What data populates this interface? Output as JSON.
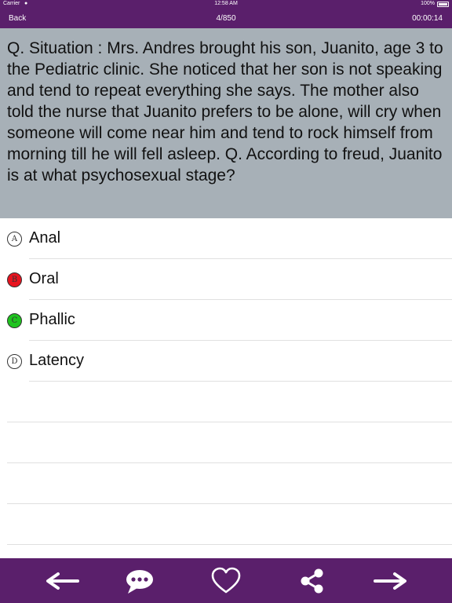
{
  "status_bar": {
    "carrier": "Carrier",
    "time": "12:58 AM",
    "battery": "100%"
  },
  "nav": {
    "back_label": "Back",
    "progress": "4/850",
    "timer": "00:00:14"
  },
  "question": {
    "text": "Q. Situation : Mrs. Andres brought his son, Juanito, age 3 to the Pediatric clinic. She noticed that her son is not speaking and tend to repeat everything she says. The mother also told the nurse that Juanito prefers to be alone, will cry when someone will come near him and tend to rock himself from morning till he will fell asleep. Q. According to freud, Juanito is at what psychosexual stage?"
  },
  "options": [
    {
      "letter": "A",
      "text": "Anal",
      "state": "neutral",
      "color": "#ffffff"
    },
    {
      "letter": "B",
      "text": "Oral",
      "state": "wrong",
      "color": "#e8131f"
    },
    {
      "letter": "C",
      "text": "Phallic",
      "state": "correct",
      "color": "#1fc41f"
    },
    {
      "letter": "D",
      "text": "Latency",
      "state": "neutral",
      "color": "#ffffff"
    }
  ],
  "toolbar": {
    "icons": [
      "arrow-left-icon",
      "chat-bubble-icon",
      "heart-icon",
      "share-icon",
      "arrow-right-icon"
    ]
  },
  "colors": {
    "header": "#5a1f6b",
    "question_bg": "#a7b0b7",
    "wrong": "#e8131f",
    "correct": "#1fc41f"
  }
}
